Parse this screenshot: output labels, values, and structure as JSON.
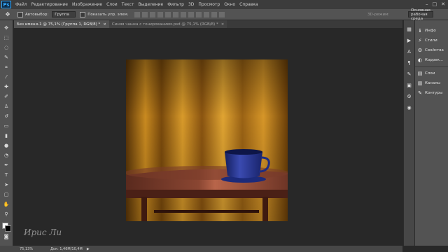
{
  "menubar": {
    "logo": "Ps",
    "items": [
      "Файл",
      "Редактирование",
      "Изображение",
      "Слои",
      "Текст",
      "Выделение",
      "Фильтр",
      "3D",
      "Просмотр",
      "Окно",
      "Справка"
    ],
    "window_controls": [
      "–",
      "□",
      "✕"
    ]
  },
  "options_bar": {
    "autoselect_label": "Автовыбор:",
    "autoselect_value": "Группа",
    "show_transform_label": "Показать упр. элем.",
    "mode_3d_label": "3D-режим:",
    "workspace_value": "Основная рабочая среда"
  },
  "tabs": [
    {
      "label": "Без имени-1 @ 75,1% (Группа 1, RGB/8) *",
      "close": "×"
    },
    {
      "label": "Синяя чашка с тонированием.psd @ 75,1% (RGB/8) *",
      "close": "×"
    }
  ],
  "panels": {
    "group1": [
      {
        "icon": "ℹ",
        "label": "Инфо"
      },
      {
        "icon": "⚡",
        "label": "Стили"
      },
      {
        "icon": "⚙",
        "label": "Свойства"
      },
      {
        "icon": "◐",
        "label": "Коррек..."
      }
    ],
    "group2": [
      {
        "icon": "▤",
        "label": "Слои"
      },
      {
        "icon": "▥",
        "label": "Каналы"
      },
      {
        "icon": "✎",
        "label": "Контуры"
      }
    ]
  },
  "status": {
    "zoom": "75,13%",
    "doc": "Док: 1,46M/10,4M",
    "arrow": "▶"
  },
  "watermark": "Ирис Ли",
  "colors": {
    "curtain": "#b8791a",
    "table": "#6e3526",
    "cup": "#26358a",
    "foreground": "#ffffff",
    "background": "#000000"
  }
}
